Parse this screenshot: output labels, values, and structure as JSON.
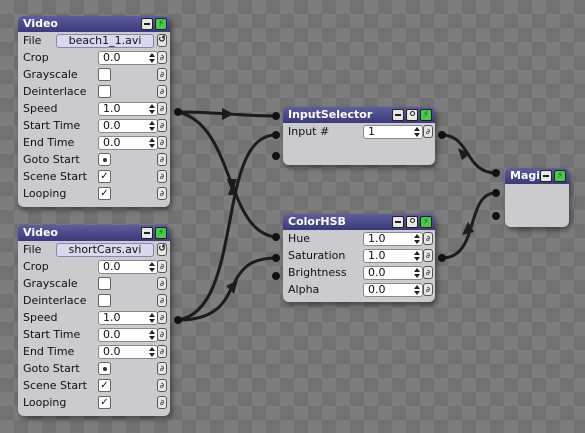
{
  "nodes": {
    "video1": {
      "title": "Video",
      "file": "beach1_1.avi",
      "rows": [
        {
          "label": "File"
        },
        {
          "label": "Crop",
          "value": "0.0"
        },
        {
          "label": "Grayscale",
          "checked": false
        },
        {
          "label": "Deinterlace",
          "checked": false
        },
        {
          "label": "Speed",
          "value": "1.0"
        },
        {
          "label": "Start Time",
          "value": "0.0"
        },
        {
          "label": "End Time",
          "value": "0.0"
        },
        {
          "label": "Goto Start"
        },
        {
          "label": "Scene Start",
          "checked": true,
          "mark": "✓"
        },
        {
          "label": "Looping",
          "checked": true,
          "mark": "✓"
        }
      ]
    },
    "video2": {
      "title": "Video",
      "file": "shortCars.avi",
      "rows": [
        {
          "label": "File"
        },
        {
          "label": "Crop",
          "value": "0.0"
        },
        {
          "label": "Grayscale",
          "checked": false
        },
        {
          "label": "Deinterlace",
          "checked": false
        },
        {
          "label": "Speed",
          "value": "1.0"
        },
        {
          "label": "Start Time",
          "value": "0.0"
        },
        {
          "label": "End Time",
          "value": "0.0"
        },
        {
          "label": "Goto Start"
        },
        {
          "label": "Scene Start",
          "checked": true,
          "mark": "✓"
        },
        {
          "label": "Looping",
          "checked": true,
          "mark": "✓"
        }
      ]
    },
    "inputSelector": {
      "title": "InputSelector",
      "input_label": "Input #",
      "input_value": "1"
    },
    "colorHSB": {
      "title": "ColorHSB",
      "rows": [
        {
          "label": "Hue",
          "value": "1.0"
        },
        {
          "label": "Saturation",
          "value": "1.0"
        },
        {
          "label": "Brightness",
          "value": "0.0"
        },
        {
          "label": "Alpha",
          "value": "0.0"
        }
      ]
    },
    "magic": {
      "title": "Magic"
    }
  },
  "icons": {
    "minimize": "minimize-icon",
    "power": "power-bolt-icon",
    "bypass": "bypass-circle-icon",
    "link": "link-chain-icon",
    "refresh": "refresh-icon",
    "bolt_glyph": "⚡",
    "link_glyph": "∂",
    "refresh_glyph": "↺"
  },
  "colors": {
    "header": "#3a3a7a",
    "node_body": "#cbcbcf",
    "power_green": "#49c84a",
    "wire": "#1a1a1a"
  }
}
